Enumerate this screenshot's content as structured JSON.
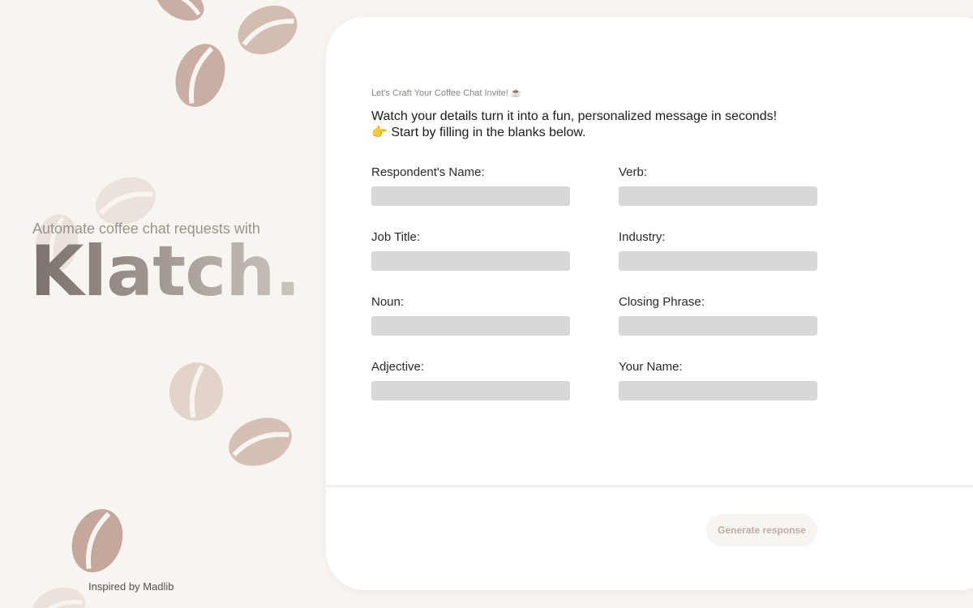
{
  "hero": {
    "subtitle": "Automate coffee chat requests with",
    "logo": "Klatch."
  },
  "footer": {
    "credit": "Inspired by Madlib"
  },
  "form": {
    "eyebrow": "Let's Craft Your Coffee Chat Invite! ☕",
    "lead_line1": "Watch your details turn it into a fun, personalized message in seconds!",
    "lead_line2": "👉 Start by filling in the blanks below.",
    "fields": [
      {
        "label": "Respondent's Name:",
        "value": ""
      },
      {
        "label": "Verb:",
        "value": ""
      },
      {
        "label": "Job Title:",
        "value": ""
      },
      {
        "label": "Industry:",
        "value": ""
      },
      {
        "label": "Noun:",
        "value": ""
      },
      {
        "label": "Closing Phrase:",
        "value": ""
      },
      {
        "label": "Adjective:",
        "value": ""
      },
      {
        "label": "Your Name:",
        "value": ""
      }
    ],
    "generate_label": "Generate response"
  },
  "decor": {
    "bean_icon": "coffee-bean-icon",
    "colors": {
      "background": "#f8f5f1",
      "bean_dark": "#c4a89c",
      "bean_light": "#e7dbd4",
      "input_fill": "#d8d8d8",
      "button_text": "#c2aba0"
    }
  }
}
